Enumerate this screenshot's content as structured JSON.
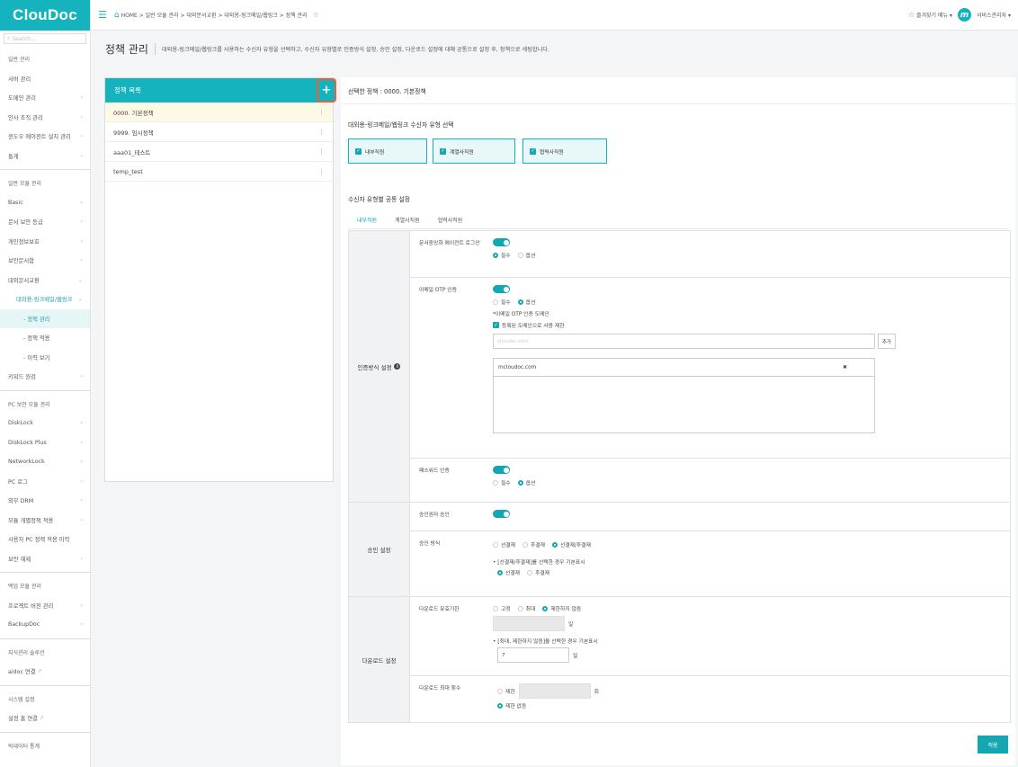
{
  "app": {
    "logo": "ClouDoc",
    "search_placeholder": "Search..."
  },
  "sidebar": {
    "items": [
      {
        "label": "일반 관리",
        "type": "section"
      },
      {
        "label": "서버 관리",
        "type": "item"
      },
      {
        "label": "도메인 관리",
        "type": "item",
        "chev": "›"
      },
      {
        "label": "인사 조직 관리",
        "type": "item",
        "chev": "›"
      },
      {
        "label": "윈도우 에이전트 설치 관리",
        "type": "item",
        "chev": "›"
      },
      {
        "label": "통계",
        "type": "item",
        "chev": "›"
      },
      {
        "label": "일반 모듈 관리",
        "type": "section"
      },
      {
        "label": "Basic",
        "type": "item",
        "chev": "›"
      },
      {
        "label": "문서 보안 등급",
        "type": "item",
        "chev": "›"
      },
      {
        "label": "개인정보보호",
        "type": "item",
        "chev": "›"
      },
      {
        "label": "보안문서함",
        "type": "item",
        "chev": "›"
      },
      {
        "label": "대외문서교환",
        "type": "item",
        "chev": "⌄"
      },
      {
        "label": "대외용-링크메일/웹링크",
        "type": "sub",
        "chev": "⌄"
      },
      {
        "label": "- 정책 관리",
        "type": "subsub-active"
      },
      {
        "label": "- 정책 적용",
        "type": "subsub"
      },
      {
        "label": "- 이력 보기",
        "type": "subsub"
      },
      {
        "label": "키워드 원검",
        "type": "item",
        "chev": "›"
      },
      {
        "label": "PC 보안 모듈 관리",
        "type": "section"
      },
      {
        "label": "DiskLock",
        "type": "item",
        "chev": "›"
      },
      {
        "label": "DiskLock Plus",
        "type": "item",
        "chev": "›"
      },
      {
        "label": "NetworkLock",
        "type": "item",
        "chev": "›"
      },
      {
        "label": "PC 로그",
        "type": "item",
        "chev": "›"
      },
      {
        "label": "외부 DRM",
        "type": "item",
        "chev": "›"
      },
      {
        "label": "모듈 개별정책 적용",
        "type": "item",
        "chev": "›"
      },
      {
        "label": "사용자 PC 정책 적용 이력",
        "type": "item"
      },
      {
        "label": "보안 해제",
        "type": "item",
        "chev": "›"
      },
      {
        "label": "백업 모듈 관리",
        "type": "section"
      },
      {
        "label": "프로젝트 버전 관리",
        "type": "item",
        "chev": "›"
      },
      {
        "label": "BackupDoc",
        "type": "item",
        "chev": "›"
      },
      {
        "label": "지식관리 솔루션",
        "type": "section"
      },
      {
        "label": "aidoc 연결",
        "type": "item-ext"
      },
      {
        "label": "시스템 설정",
        "type": "section"
      },
      {
        "label": "설정 홈 연결",
        "type": "item-ext"
      },
      {
        "label": "빅데이터 통계",
        "type": "section"
      }
    ]
  },
  "topbar": {
    "breadcrumb": "HOME > 일반 모듈 관리 > 대외문서교환 > 대외용-링크메일/웹링크 > 정책 관리",
    "favorites": "즐겨찾기 메뉴 ▾",
    "avatar_letter": "m",
    "user": "서비스관리자 ▾"
  },
  "page": {
    "title": "정책 관리",
    "description": "대외용-링크메일/웹링크를 사용하는 수신자 유형을 선택하고, 수신자 유형별로 인증방식 설정, 승인 설정, 다운로드 설정에 대해 공통으로 설정 후, 정책으로 세팅합니다."
  },
  "policy_list": {
    "header": "정책 목록",
    "add": "+",
    "rows": [
      "0000. 기본정책",
      "9999. 임시정책",
      "aaa01_테스트",
      "temp_test"
    ],
    "kebab": "⋮"
  },
  "detail": {
    "selected": "선택한 정책 : 0000. 기본정책",
    "recipient_type_title": "대외용-링크메일/웹링크 수신자 유형 선택",
    "recipient_types": [
      "내부직원",
      "계열사직원",
      "협력사직원"
    ],
    "common_settings_title": "수신자 유형별 공통 설정",
    "tabs": [
      "내부직원",
      "계열사직원",
      "협력사직원"
    ],
    "auth": {
      "label": "인증방식 설정",
      "agent_login_label": "문서중앙화 에이전트 로그인",
      "required": "필수",
      "optional": "옵션",
      "email_otp_label": "이메일 OTP 인증",
      "email_otp_note": "*이메일 OTP 인증 도메인",
      "registered_only": "등록된 도메인으로 사용 제한",
      "domain_placeholder": "cloudoc.com",
      "add_button": "추가",
      "domains": [
        "mcloudoc.com"
      ],
      "remove": "✖",
      "password_label": "패스워드 인증"
    },
    "approval": {
      "label": "승인 설정",
      "approver_label": "승인권자 승인",
      "method_label": "승인 방식",
      "methods": [
        "선결재",
        "후결재",
        "선결재/후결재"
      ],
      "default_note": "• [선결재/후결재]를 선택한 경우 기본표시",
      "default_options": [
        "선결재",
        "후결재"
      ]
    },
    "download": {
      "label": "다운로드 설정",
      "period_label": "다운로드 유효기한",
      "period_options": [
        "고정",
        "최대",
        "제한하지 않음"
      ],
      "unit_day": "일",
      "period_note": "• [최대, 제한하지 않음]을 선택한 경우 기본표시",
      "period_default": "7",
      "count_label": "다운로드 최대 횟수",
      "count_limit": "제한",
      "count_unit": "회",
      "count_unlimited": "제한 없음"
    },
    "apply": "적용"
  },
  "colors": {
    "accent": "#15b3bd",
    "highlight": "#e8613a"
  }
}
